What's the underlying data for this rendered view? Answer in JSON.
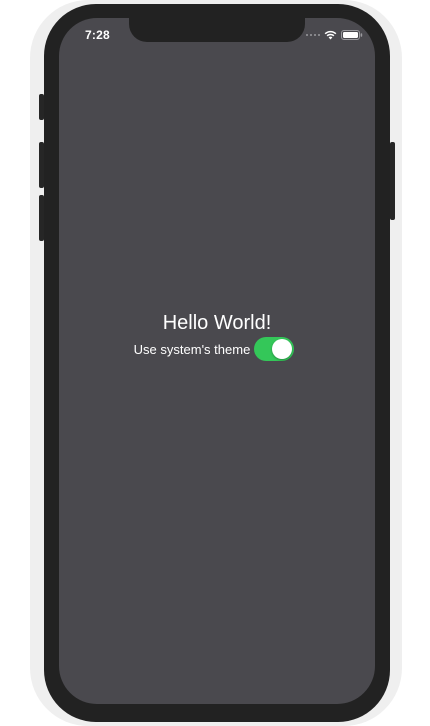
{
  "status_bar": {
    "time": "7:28",
    "icons": [
      "cellular-signal-icon",
      "wifi-icon",
      "battery-icon"
    ]
  },
  "main": {
    "greeting": "Hello World!",
    "theme_toggle": {
      "label": "Use system's theme",
      "on": true
    }
  },
  "colors": {
    "screen_background": "#4a494e",
    "text": "#ffffff",
    "toggle_on": "#34c759",
    "device_frame": "#222222"
  }
}
